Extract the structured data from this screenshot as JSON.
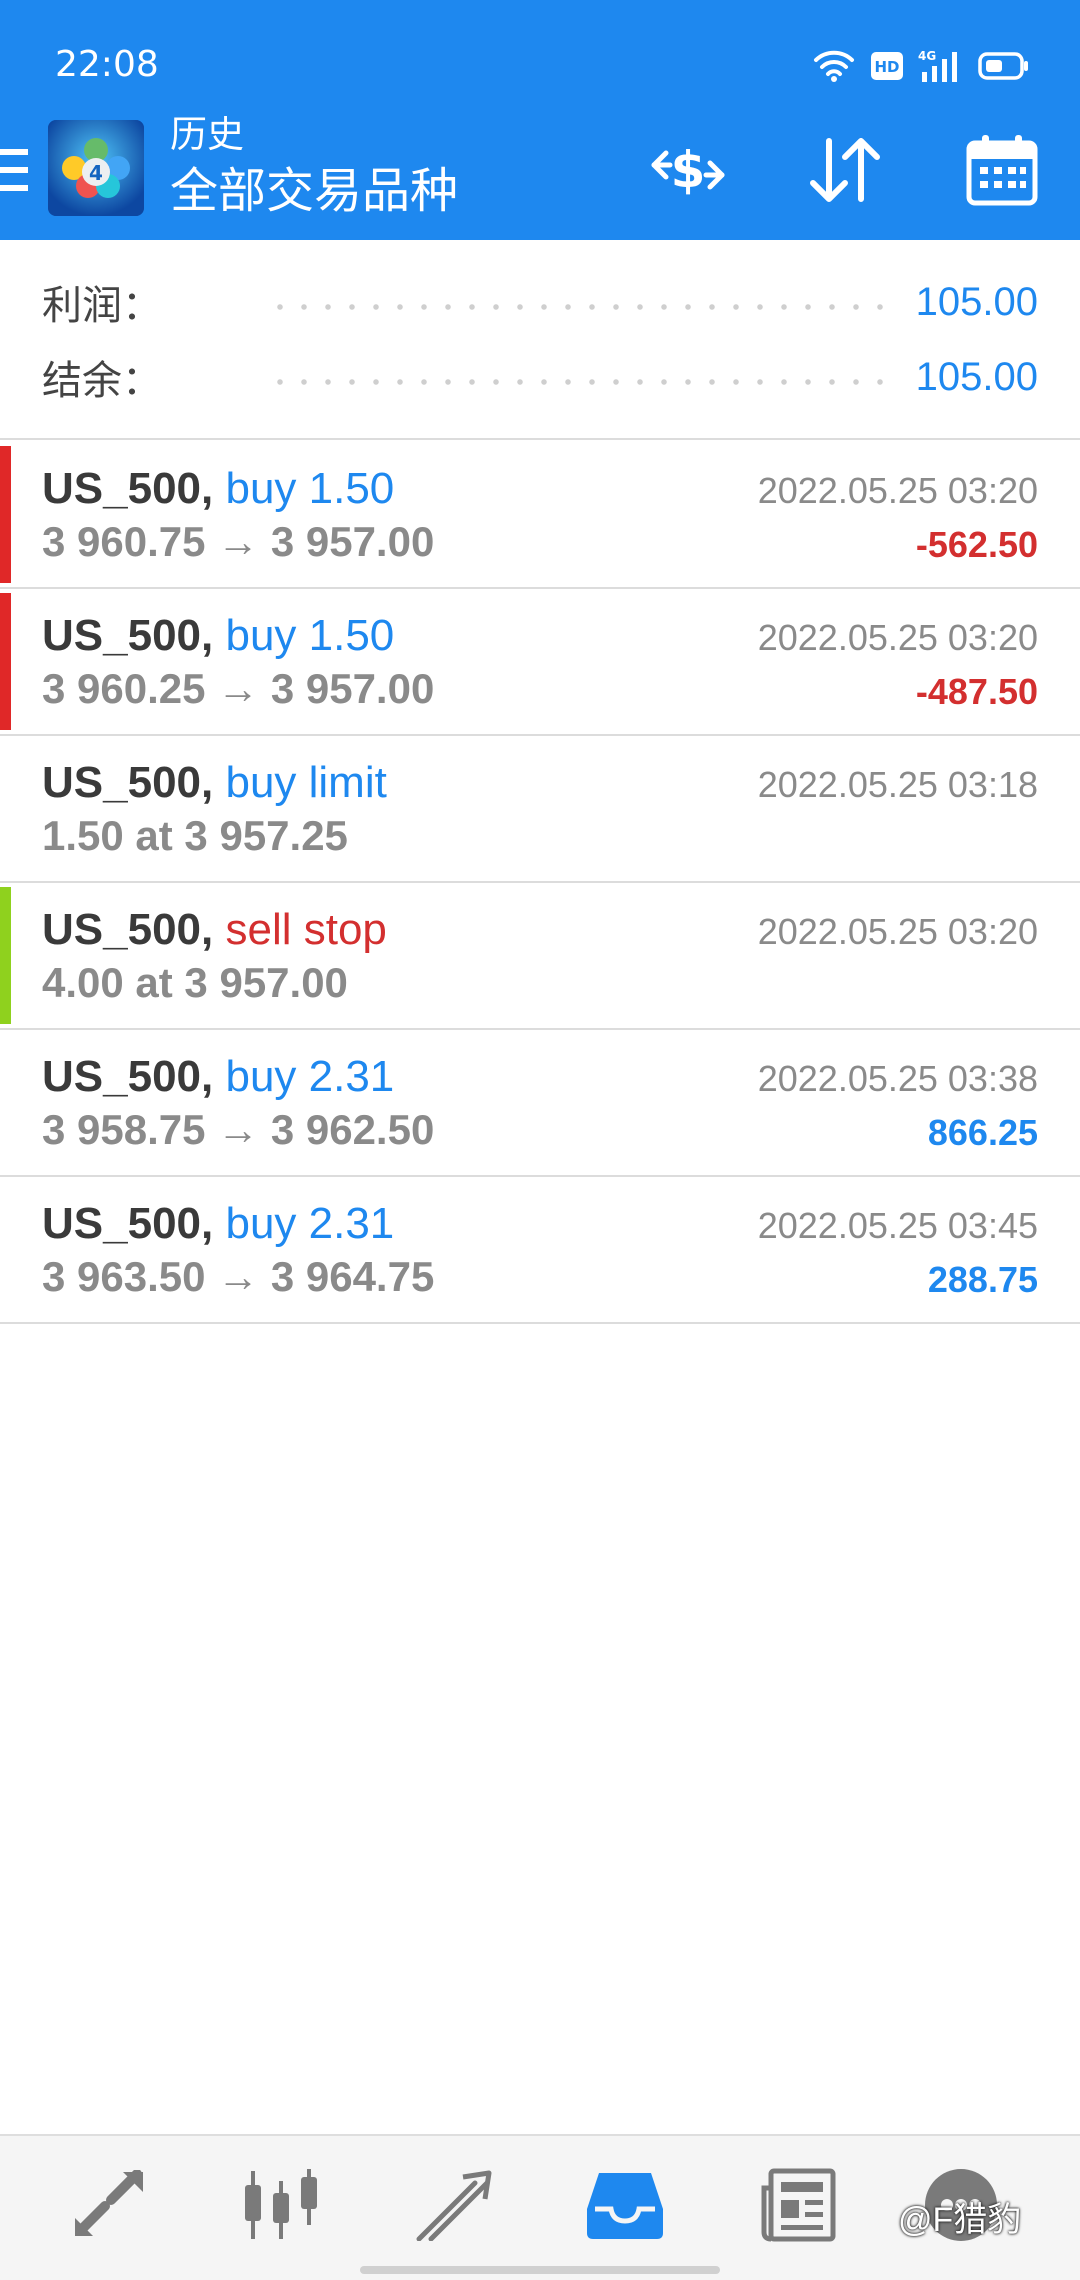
{
  "status_bar": {
    "time": "22:08",
    "icons": [
      "wifi-icon",
      "hd-icon",
      "4g-signal-icon",
      "battery-icon"
    ],
    "hd_label": "HD",
    "network_label": "4G"
  },
  "header": {
    "breadcrumb": "历史",
    "title": "全部交易品种",
    "actions": [
      "currency-exchange-icon",
      "sort-icon",
      "calendar-icon"
    ]
  },
  "summary": {
    "profit_label": "利润：",
    "profit_value": "105.00",
    "balance_label": "结余：",
    "balance_value": "105.00"
  },
  "trades": [
    {
      "symbol": "US_500,",
      "type": "buy 1.50",
      "type_color": "#1e88ef",
      "detail": "3 960.75 → 3 957.00",
      "time": "2022.05.25 03:20",
      "profit": "-562.50",
      "profit_color": "#d32f2f",
      "bar_color": "#e02828"
    },
    {
      "symbol": "US_500,",
      "type": "buy 1.50",
      "type_color": "#1e88ef",
      "detail": "3 960.25 → 3 957.00",
      "time": "2022.05.25 03:20",
      "profit": "-487.50",
      "profit_color": "#d32f2f",
      "bar_color": "#e02828"
    },
    {
      "symbol": "US_500,",
      "type": "buy limit",
      "type_color": "#1e88ef",
      "detail": "1.50 at 3 957.25",
      "time": "2022.05.25 03:18",
      "profit": "",
      "profit_color": "#1e88ef",
      "bar_color": "transparent"
    },
    {
      "symbol": "US_500,",
      "type": "sell stop",
      "type_color": "#d32f2f",
      "detail": "4.00 at 3 957.00",
      "time": "2022.05.25 03:20",
      "profit": "",
      "profit_color": "#1e88ef",
      "bar_color": "#8fd11e"
    },
    {
      "symbol": "US_500,",
      "type": "buy 2.31",
      "type_color": "#1e88ef",
      "detail": "3 958.75 → 3 962.50",
      "time": "2022.05.25 03:38",
      "profit": "866.25",
      "profit_color": "#1e88ef",
      "bar_color": "transparent"
    },
    {
      "symbol": "US_500,",
      "type": "buy 2.31",
      "type_color": "#1e88ef",
      "detail": "3 963.50 → 3 964.75",
      "time": "2022.05.25 03:45",
      "profit": "288.75",
      "profit_color": "#1e88ef",
      "bar_color": "transparent"
    }
  ],
  "bottom_nav": {
    "items": [
      "quotes-icon",
      "chart-icon",
      "trade-icon",
      "history-icon",
      "news-icon",
      "messages-icon"
    ],
    "active": "history-icon"
  },
  "watermark": "@F猎豹",
  "colors": {
    "accent": "#1e88ef",
    "loss": "#d32f2f",
    "bar_loss": "#e02828",
    "bar_green": "#8fd11e"
  }
}
